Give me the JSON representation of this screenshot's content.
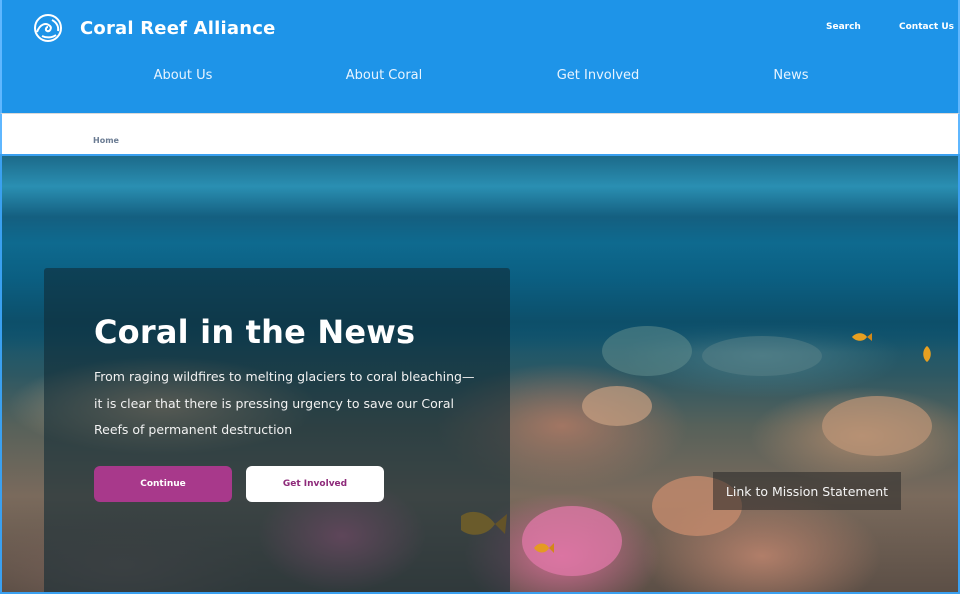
{
  "header": {
    "brand_name": "Coral Reef Alliance",
    "utility_links": {
      "search": "Search",
      "contact": "Contact Us"
    },
    "nav": [
      "About Us",
      "About Coral",
      "Get Involved",
      "News"
    ]
  },
  "breadcrumb": {
    "home": "Home"
  },
  "hero": {
    "title": "Coral in the News",
    "description": "From raging wildfires to melting glaciers to coral bleaching—it is clear that there is pressing urgency to save our Coral Reefs of permanent destruction",
    "buttons": {
      "continue": "Continue",
      "get_involved": "Get Involved"
    },
    "mission_link": "Link to Mission Statement"
  },
  "colors": {
    "header_bg": "#1e94e8",
    "continue_button": "#a8398b",
    "get_involved_text": "#8e2a7a"
  },
  "icons": {
    "logo": "wave-logo-icon"
  }
}
